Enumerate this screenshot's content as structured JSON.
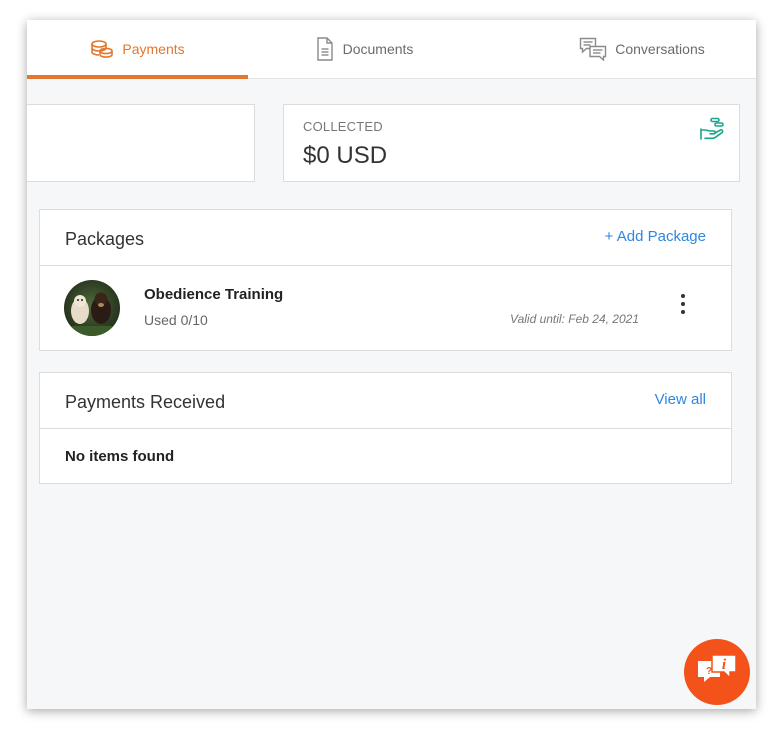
{
  "tabs": [
    {
      "label": "Payments",
      "icon": "coins-icon",
      "active": true
    },
    {
      "label": "Documents",
      "icon": "document-icon",
      "active": false
    },
    {
      "label": "Conversations",
      "icon": "chat-bubbles-icon",
      "active": false
    }
  ],
  "stats": {
    "collected": {
      "label": "COLLECTED",
      "value": "$0 USD",
      "icon": "hand-money-icon"
    }
  },
  "packages": {
    "title": "Packages",
    "action": "+ Add Package",
    "items": [
      {
        "name": "Obedience Training",
        "used": "Used 0/10",
        "valid": "Valid until: Feb 24, 2021"
      }
    ]
  },
  "payments_received": {
    "title": "Payments Received",
    "action": "View all",
    "empty": "No items found"
  },
  "colors": {
    "accent": "#e2772f",
    "link": "#2f86e0",
    "help_button": "#f3531b",
    "collected_icon": "#1aa68a"
  }
}
